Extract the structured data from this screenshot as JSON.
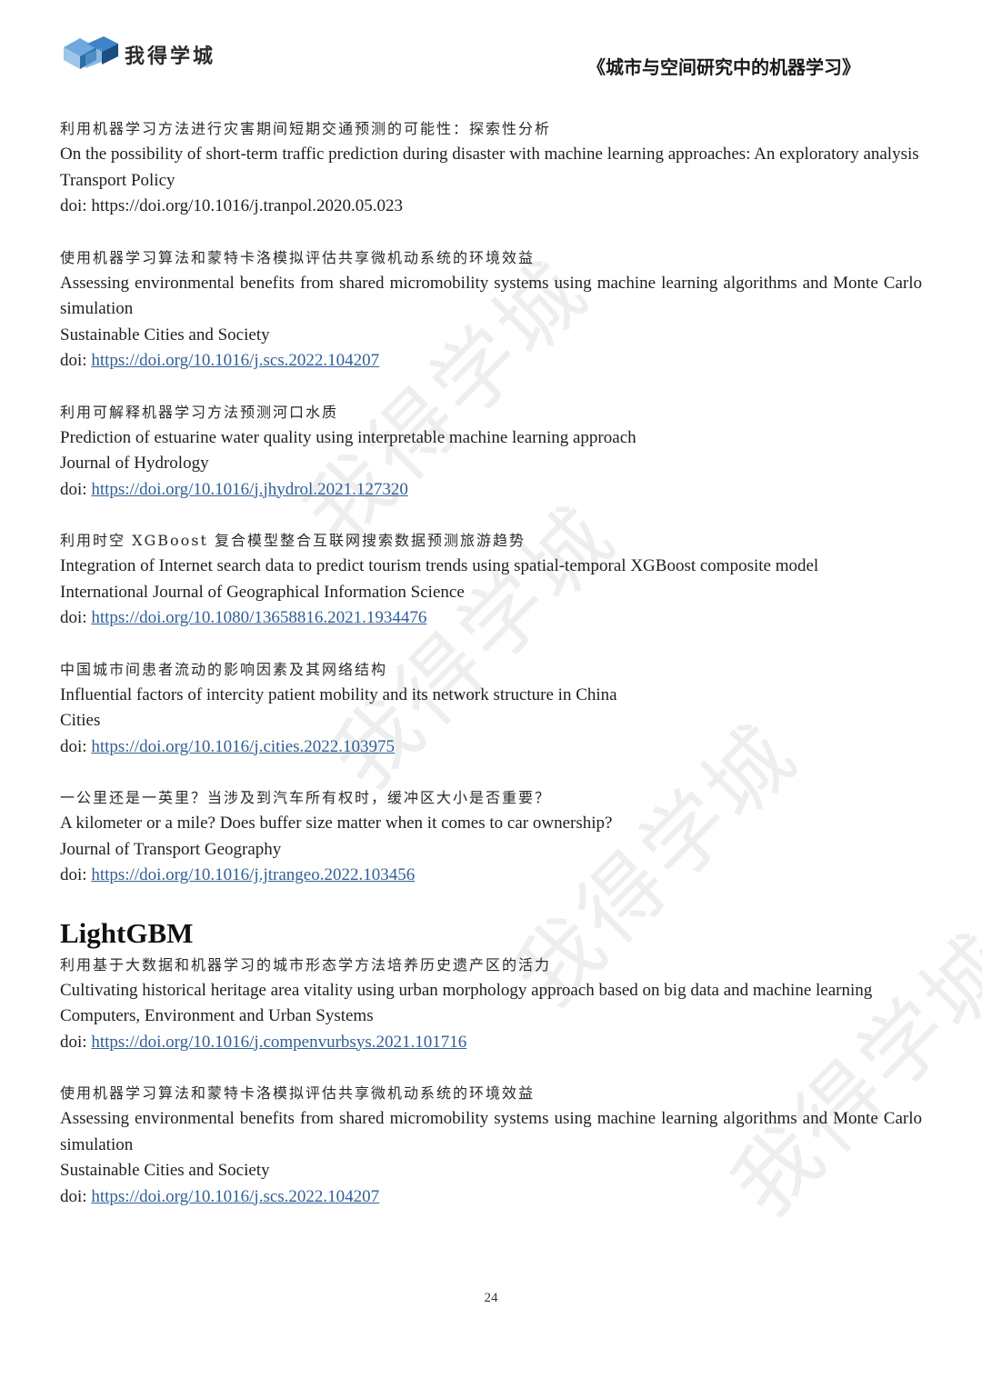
{
  "header": {
    "brand": "我得学城",
    "book_title": "《城市与空间研究中的机器学习》"
  },
  "watermark": "我得学城",
  "entries_top": [
    {
      "zh": "利用机器学习方法进行灾害期间短期交通预测的可能性：探索性分析",
      "en": "On the possibility of short-term traffic prediction during disaster with machine learning approaches: An exploratory analysis",
      "journal": "Transport Policy",
      "doi_prefix": "doi: ",
      "doi_url": "https://doi.org/10.1016/j.tranpol.2020.05.023",
      "doi_linked": false
    },
    {
      "zh": "使用机器学习算法和蒙特卡洛模拟评估共享微机动系统的环境效益",
      "en": "Assessing environmental benefits from shared micromobility systems using machine learning algorithms and Monte Carlo simulation",
      "journal": "Sustainable Cities and Society",
      "doi_prefix": "doi: ",
      "doi_url": "https://doi.org/10.1016/j.scs.2022.104207",
      "doi_linked": true
    },
    {
      "zh": "利用可解释机器学习方法预测河口水质",
      "en": "Prediction of estuarine water quality using interpretable machine learning approach",
      "journal": "Journal of Hydrology",
      "doi_prefix": "doi: ",
      "doi_url": "https://doi.org/10.1016/j.jhydrol.2021.127320",
      "doi_linked": true
    },
    {
      "zh": "利用时空 XGBoost 复合模型整合互联网搜索数据预测旅游趋势",
      "en": "Integration of Internet search data to predict tourism trends using spatial-temporal XGBoost composite model",
      "journal": "International Journal of Geographical Information Science",
      "doi_prefix": "doi: ",
      "doi_url": "https://doi.org/10.1080/13658816.2021.1934476",
      "doi_linked": true
    },
    {
      "zh": "中国城市间患者流动的影响因素及其网络结构",
      "en": "Influential factors of intercity patient mobility and its network structure in China",
      "journal": "Cities",
      "doi_prefix": "doi: ",
      "doi_url": "https://doi.org/10.1016/j.cities.2022.103975",
      "doi_linked": true
    },
    {
      "zh": "一公里还是一英里？当涉及到汽车所有权时，缓冲区大小是否重要？",
      "en": "A kilometer or a mile? Does buffer size matter when it comes to car ownership?",
      "journal": "Journal of Transport Geography",
      "doi_prefix": "doi: ",
      "doi_url": "https://doi.org/10.1016/j.jtrangeo.2022.103456",
      "doi_linked": true
    }
  ],
  "section_heading": "LightGBM",
  "entries_bottom": [
    {
      "zh": "利用基于大数据和机器学习的城市形态学方法培养历史遗产区的活力",
      "en": "Cultivating historical heritage area vitality using urban morphology approach based on big data and machine learning",
      "journal": "Computers, Environment and Urban Systems",
      "doi_prefix": "doi: ",
      "doi_url": "https://doi.org/10.1016/j.compenvurbsys.2021.101716",
      "doi_linked": true
    },
    {
      "zh": "使用机器学习算法和蒙特卡洛模拟评估共享微机动系统的环境效益",
      "en": "Assessing environmental benefits from shared micromobility systems using machine learning algorithms and Monte Carlo simulation",
      "journal": "Sustainable Cities and Society",
      "doi_prefix": "doi: ",
      "doi_url": "https://doi.org/10.1016/j.scs.2022.104207",
      "doi_linked": true
    }
  ],
  "page_number": "24"
}
